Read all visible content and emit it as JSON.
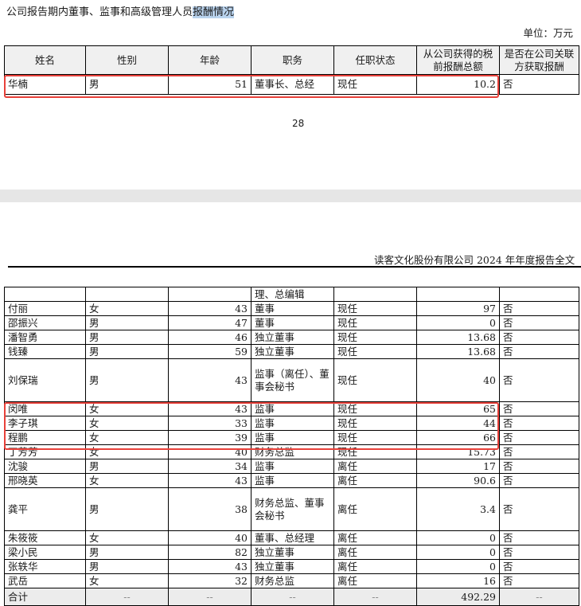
{
  "top": {
    "title_plain": "公司报告期内董事、监事和高级管理人员",
    "title_highlight": "报酬情况",
    "unit": "单位：万元",
    "page_number": "28"
  },
  "columns": [
    "姓名",
    "性别",
    "年龄",
    "职务",
    "任职状态",
    "从公司获得的税前报酬总额",
    "是否在公司关联方获取报酬"
  ],
  "first_row": [
    "华楠",
    "男",
    "51",
    "董事长、总经",
    "现任",
    "10.2",
    "否"
  ],
  "running_header": "读客文化股份有限公司 2024 年年度报告全文",
  "continuation_row": [
    "",
    "",
    "",
    "理、总编辑",
    "",
    "",
    ""
  ],
  "rows": [
    [
      "付丽",
      "女",
      "43",
      "董事",
      "现任",
      "97",
      "否"
    ],
    [
      "邵振兴",
      "男",
      "47",
      "董事",
      "现任",
      "0",
      "否"
    ],
    [
      "潘智勇",
      "男",
      "46",
      "独立董事",
      "现任",
      "13.68",
      "否"
    ],
    [
      "钱臻",
      "男",
      "59",
      "独立董事",
      "现任",
      "13.68",
      "否"
    ],
    [
      "刘保瑞",
      "男",
      "43",
      "监事（离任）、董事会秘书",
      "现任",
      "40",
      "否"
    ],
    [
      "闵唯",
      "女",
      "43",
      "监事",
      "现任",
      "65",
      "否"
    ],
    [
      "李子琪",
      "女",
      "33",
      "监事",
      "现任",
      "44",
      "否"
    ],
    [
      "程鹏",
      "女",
      "39",
      "监事",
      "现任",
      "66",
      "否"
    ],
    [
      "丁芳芳",
      "女",
      "40",
      "财务总监",
      "现任",
      "15.73",
      "否"
    ],
    [
      "沈骏",
      "男",
      "34",
      "监事",
      "离任",
      "17",
      "否"
    ],
    [
      "邢晓英",
      "女",
      "43",
      "监事",
      "离任",
      "90.6",
      "否"
    ],
    [
      "龚平",
      "男",
      "38",
      "财务总监、董事会秘书",
      "离任",
      "3.4",
      "否"
    ],
    [
      "朱筱筱",
      "女",
      "40",
      "董事、总经理",
      "离任",
      "0",
      "否"
    ],
    [
      "梁小民",
      "男",
      "82",
      "独立董事",
      "离任",
      "0",
      "否"
    ],
    [
      "张轶华",
      "男",
      "43",
      "独立董事",
      "离任",
      "0",
      "否"
    ],
    [
      "武岳",
      "女",
      "32",
      "财务总监",
      "离任",
      "16",
      "否"
    ]
  ],
  "total_row": [
    "合计",
    "--",
    "--",
    "--",
    "--",
    "492.29",
    "--"
  ],
  "colors": {
    "highlight_box": "#e8413a",
    "title_highlight": "#b9d3ee",
    "header_fill": "#f0f0f0"
  }
}
